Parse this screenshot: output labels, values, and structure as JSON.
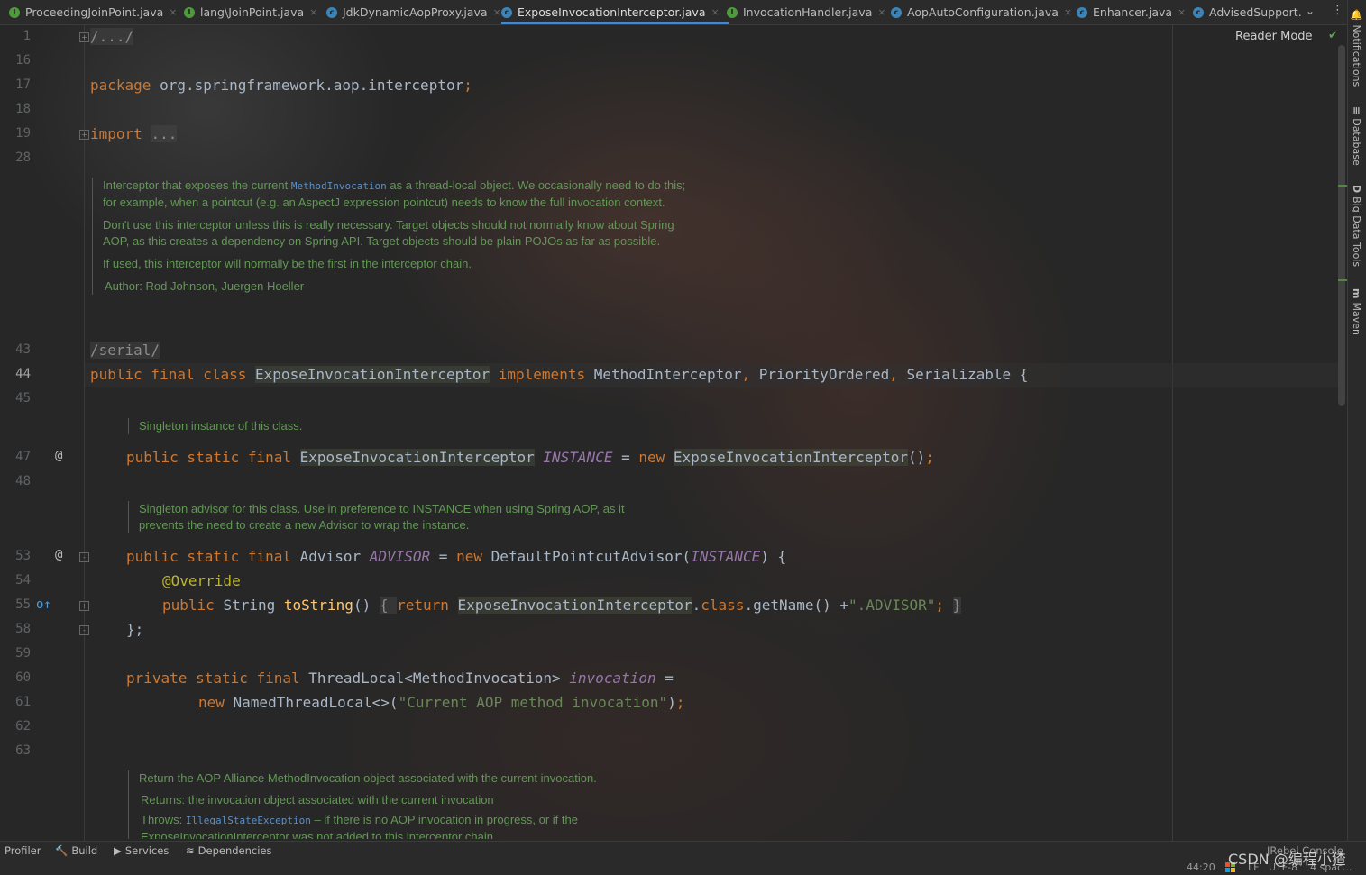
{
  "tabs": [
    {
      "label": "ProceedingJoinPoint.java",
      "icon": "interface-icon"
    },
    {
      "label": "lang\\JoinPoint.java",
      "icon": "interface-icon"
    },
    {
      "label": "JdkDynamicAopProxy.java",
      "icon": "class-icon"
    },
    {
      "label": "ExposeInvocationInterceptor.java",
      "icon": "class-icon",
      "active": true
    },
    {
      "label": "InvocationHandler.java",
      "icon": "interface-icon"
    },
    {
      "label": "AopAutoConfiguration.java",
      "icon": "class-icon"
    },
    {
      "label": "Enhancer.java",
      "icon": "class-icon"
    },
    {
      "label": "AdvisedSupport.",
      "icon": "class-icon"
    }
  ],
  "tab_close_glyph": "×",
  "reader_mode": "Reader Mode",
  "right_tools": [
    "Notifications",
    "Database",
    "Big Data Tools",
    "Maven"
  ],
  "right_tool_icons": [
    "🔔",
    "≡",
    "D",
    "m"
  ],
  "line_numbers": [
    "1",
    "16",
    "17",
    "18",
    "19",
    "28",
    "43",
    "44",
    "45",
    "47",
    "48",
    "53",
    "54",
    "55",
    "58",
    "59",
    "60",
    "61",
    "62",
    "63"
  ],
  "current_line": "44",
  "gutter_marks": {
    "l47": "@",
    "l53": "@",
    "l55": "o↑"
  },
  "code": {
    "l1": "/.../",
    "l17_kw": "package",
    "l17_rest": " org.springframework.aop.interceptor",
    "l17_semi": ";",
    "l19_kw": "import",
    "l19_fold": "...",
    "l43": "/serial/",
    "l44_kw": "public final class ",
    "l44_cls": "ExposeInvocationInterceptor",
    "l44_impl": " implements ",
    "l44_i1": "MethodInterceptor",
    "l44_c1": ", ",
    "l44_i2": "PriorityOrdered",
    "l44_c2": ", ",
    "l44_i3": "Serializable",
    "l44_brace": " {",
    "l47_kw": "public static final ",
    "l47_cls": "ExposeInvocationInterceptor",
    "l47_sp": " ",
    "l47_field": "INSTANCE",
    "l47_eq": " = ",
    "l47_new": "new ",
    "l47_ctor": "ExposeInvocationInterceptor",
    "l47_end": "()",
    "l47_semi": ";",
    "l53_kw": "public static final ",
    "l53_type": "Advisor ",
    "l53_field": "ADVISOR",
    "l53_eq": " = ",
    "l53_new": "new ",
    "l53_ctor": "DefaultPointcutAdvisor(",
    "l53_arg": "INSTANCE",
    "l53_end": ") {",
    "l54": "@Override",
    "l55_kw": "public ",
    "l55_type": "String ",
    "l55_mth": "toString",
    "l55_par": "() ",
    "l55_ob": "{ ",
    "l55_ret": "return ",
    "l55_cls": "ExposeInvocationInterceptor",
    "l55_dot": ".",
    "l55_class": "class",
    "l55_call": ".getName() +",
    "l55_str": "\".ADVISOR\"",
    "l55_semi": "; ",
    "l55_cb": "}",
    "l58": "};",
    "l60_kw": "private static final ",
    "l60_type": "ThreadLocal<MethodInvocation> ",
    "l60_field": "invocation",
    "l60_eq": " =",
    "l61_new": "new ",
    "l61_type": "NamedThreadLocal<>(",
    "l61_str": "\"Current AOP method invocation\"",
    "l61_end": ")",
    "l61_semi": ";"
  },
  "docs": {
    "class_doc": {
      "p1_a": "Interceptor that exposes the current ",
      "p1_code": "MethodInvocation",
      "p1_b": " as a thread-local object. We occasionally need to do this; for example, when a pointcut (e.g. an AspectJ expression pointcut) needs to know the full invocation context.",
      "p2": "Don't use this interceptor unless this is really necessary. Target objects should not normally know about Spring AOP, as this creates a dependency on Spring API. Target objects should be plain POJOs as far as possible.",
      "p3": "If used, this interceptor will normally be the first in the interceptor chain.",
      "author": "Author: Rod Johnson, Juergen Hoeller"
    },
    "instance_doc": "Singleton instance of this class.",
    "advisor_doc": "Singleton advisor for this class. Use in preference to INSTANCE when using Spring AOP, as it prevents the need to create a new Advisor to wrap the instance.",
    "current_doc": {
      "p1": "Return the AOP Alliance MethodInvocation object associated with the current invocation.",
      "returns": "Returns: the invocation object associated with the current invocation",
      "throws_a": "Throws: ",
      "throws_code": "IllegalStateException",
      "throws_b": " – if there is no AOP invocation in progress, or if the ExposeInvocationInterceptor was not added to this interceptor chain"
    }
  },
  "bottom_tools": [
    {
      "label": "Profiler",
      "icon": ""
    },
    {
      "label": "Build",
      "icon": "🔨"
    },
    {
      "label": "Services",
      "icon": "▶"
    },
    {
      "label": "Dependencies",
      "icon": "≋"
    }
  ],
  "jrebel": "JRebel Console",
  "status": {
    "position": "44:20",
    "line_sep": "LF",
    "encoding": "UTF-8",
    "indent": "4 spac..."
  },
  "watermark": "CSDN @编程小猹",
  "colors": {
    "keyword": "#cc7832",
    "string": "#6a8759",
    "doc": "#629755",
    "field_italic": "#9876aa",
    "method": "#ffc66d",
    "annotation": "#bbb529",
    "active_tab_underline": "#4a88c7"
  }
}
